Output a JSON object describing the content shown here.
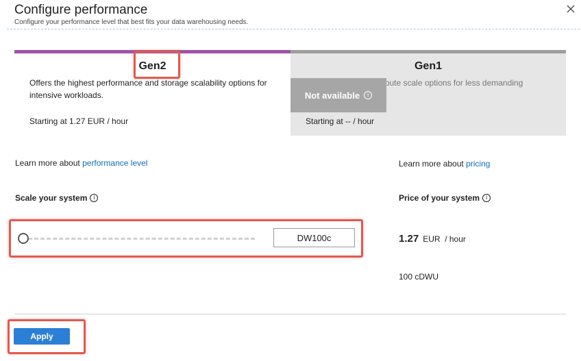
{
  "header": {
    "title": "Configure performance",
    "subtitle": "Configure your performance level that best fits your data warehousing needs."
  },
  "tiers": {
    "gen2": {
      "name": "Gen2",
      "description": "Offers the highest performance and storage scalability options for intensive workloads.",
      "price": "Starting at 1.27 EUR / hour",
      "accent": "#a052a6"
    },
    "gen1": {
      "name": "Gen1",
      "description": "Offers the lowest compute scale options for less demanding workloads.",
      "price": "Starting at -- / hour",
      "overlay": "Not available",
      "accent": "#9e9e9e"
    }
  },
  "learn_performance": {
    "prefix": "Learn more about",
    "link": "performance level"
  },
  "learn_pricing": {
    "prefix": "Learn more about",
    "link": "pricing"
  },
  "scale": {
    "label": "Scale your system",
    "value": "DW100c",
    "position": 0
  },
  "price": {
    "label": "Price of your system",
    "amount": "1.27",
    "unit": "EUR  / hour",
    "dwu": "100 cDWU"
  },
  "footer": {
    "apply": "Apply"
  },
  "colors": {
    "link": "#0f6cbd",
    "primary": "#2b7fd6",
    "highlight": "#e05a4f"
  }
}
